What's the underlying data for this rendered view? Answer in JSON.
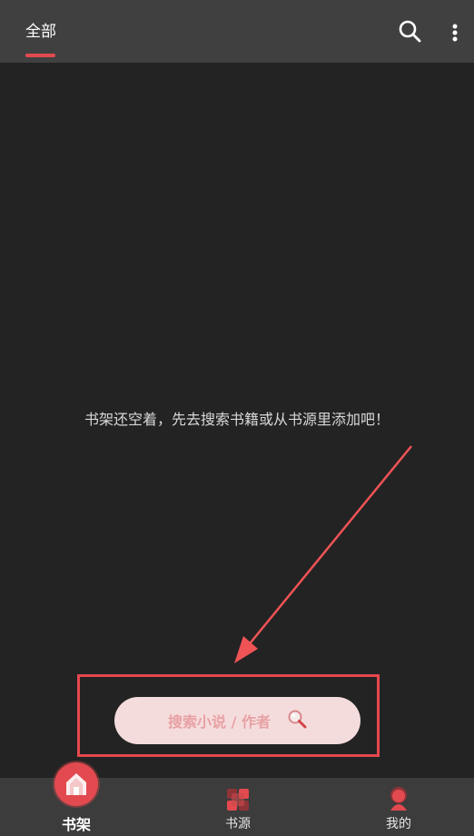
{
  "topbar": {
    "tab_label": "全部",
    "search_icon": "search-icon",
    "more_icon": "more-vertical-icon"
  },
  "main": {
    "empty_message": "书架还空着，先去搜索书籍或从书源里添加吧！"
  },
  "search": {
    "button_label": "搜索小说 / 作者",
    "icon": "magnifier-icon"
  },
  "nav": {
    "items": [
      {
        "label": "书架",
        "icon": "bookshelf-icon",
        "active": true
      },
      {
        "label": "书源",
        "icon": "grid-icon",
        "active": false
      },
      {
        "label": "我的",
        "icon": "profile-icon",
        "active": false
      }
    ]
  },
  "colors": {
    "accent": "#e24a4f",
    "background": "#232323",
    "topbar": "#404040",
    "bottombar": "#3c3c3c",
    "pill": "#f5dcdc"
  }
}
